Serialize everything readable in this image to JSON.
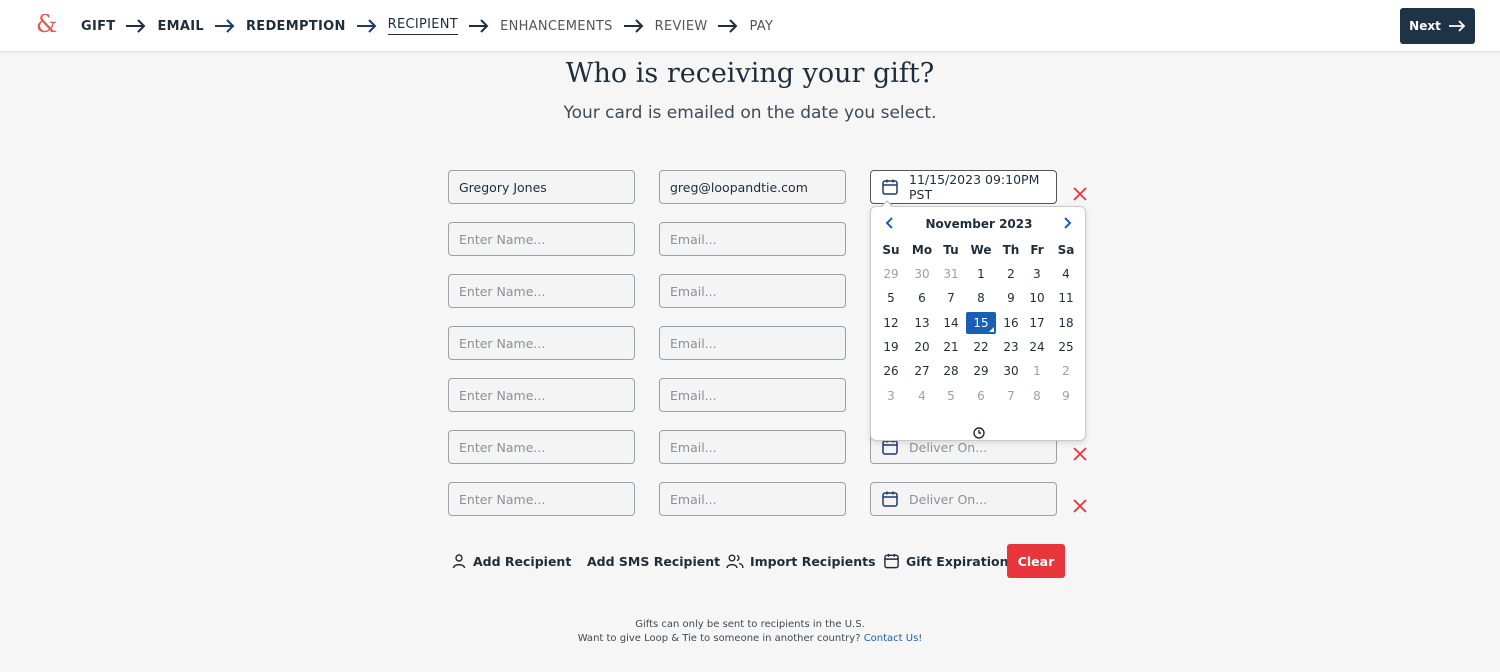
{
  "header": {
    "logo": "&",
    "steps": [
      {
        "label": "GIFT",
        "state": "done"
      },
      {
        "label": "EMAIL",
        "state": "done"
      },
      {
        "label": "REDEMPTION",
        "state": "done"
      },
      {
        "label": "RECIPIENT",
        "state": "current"
      },
      {
        "label": "ENHANCEMENTS",
        "state": "todo"
      },
      {
        "label": "REVIEW",
        "state": "todo"
      },
      {
        "label": "PAY",
        "state": "todo"
      }
    ],
    "next_label": "Next"
  },
  "page": {
    "title": "Who is receiving your gift?",
    "subtitle": "Your card is emailed on the date you select."
  },
  "recipients": [
    {
      "name": "Gregory Jones",
      "email": "greg@loopandtie.com",
      "date": "11/15/2023 09:10PM PST"
    },
    {
      "name": "",
      "email": "",
      "date": ""
    },
    {
      "name": "",
      "email": "",
      "date": ""
    },
    {
      "name": "",
      "email": "",
      "date": ""
    },
    {
      "name": "",
      "email": "",
      "date": ""
    },
    {
      "name": "",
      "email": "",
      "date": ""
    },
    {
      "name": "",
      "email": "",
      "date": ""
    }
  ],
  "placeholders": {
    "name": "Enter Name...",
    "email": "Email...",
    "date": "Deliver On..."
  },
  "datepicker": {
    "month_label": "November 2023",
    "weekdays": [
      "Su",
      "Mo",
      "Tu",
      "We",
      "Th",
      "Fr",
      "Sa"
    ],
    "weeks": [
      [
        "29",
        "30",
        "31",
        "1",
        "2",
        "3",
        "4"
      ],
      [
        "5",
        "6",
        "7",
        "8",
        "9",
        "10",
        "11"
      ],
      [
        "12",
        "13",
        "14",
        "15",
        "16",
        "17",
        "18"
      ],
      [
        "19",
        "20",
        "21",
        "22",
        "23",
        "24",
        "25"
      ],
      [
        "26",
        "27",
        "28",
        "29",
        "30",
        "1",
        "2"
      ],
      [
        "3",
        "4",
        "5",
        "6",
        "7",
        "8",
        "9"
      ]
    ],
    "selected_day": "15",
    "accent_color": "#1a5fb4"
  },
  "actions": {
    "add_recipient": "Add Recipient",
    "add_sms_recipient": "Add SMS Recipient",
    "import_recipients": "Import Recipients",
    "gift_expiration": "Gift Expiration",
    "clear": "Clear"
  },
  "footer": {
    "line1": "Gifts can only be sent to recipients in the U.S.",
    "line2": "Want to give Loop & Tie to someone in another country?",
    "contact_link": "Contact Us!"
  },
  "colors": {
    "navy": "#1f3347",
    "clear_red": "#e8343b",
    "remove_red": "#e8343b",
    "logo_coral": "#e05a4f"
  }
}
